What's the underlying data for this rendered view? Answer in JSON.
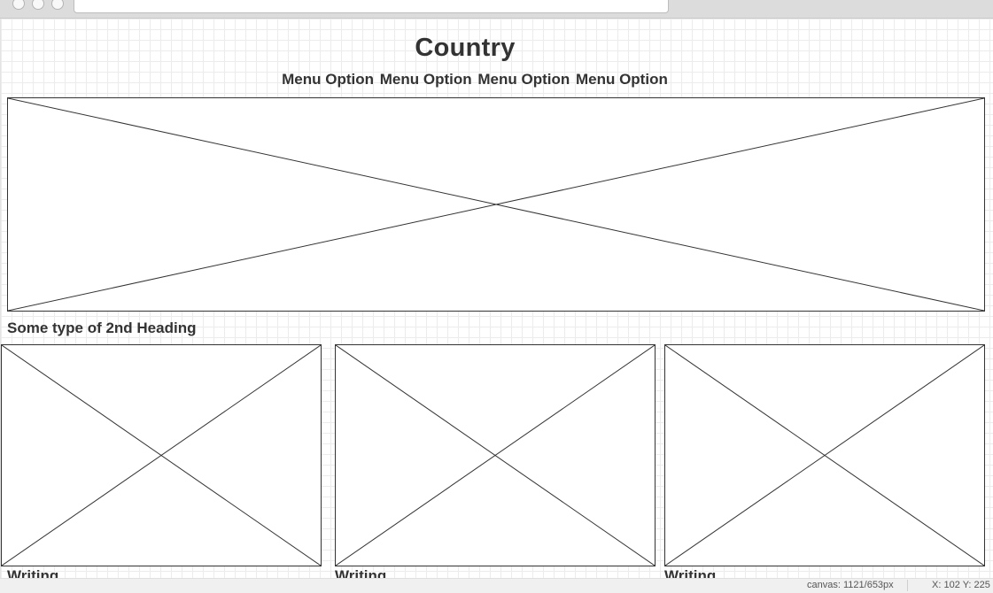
{
  "header": {
    "title": "Country"
  },
  "menu": {
    "items": [
      "Menu Option",
      "Menu Option",
      "Menu Option",
      "Menu Option"
    ]
  },
  "section": {
    "heading": "Some type of 2nd Heading"
  },
  "cards": [
    {
      "caption": "Writing"
    },
    {
      "caption": "Writing"
    },
    {
      "caption": "Writing"
    }
  ],
  "status_bar": {
    "canvas_label": "canvas:",
    "canvas_value": "1121/653px",
    "x_label": "X:",
    "x_value": "102",
    "y_label": "Y:",
    "y_value": "225"
  }
}
